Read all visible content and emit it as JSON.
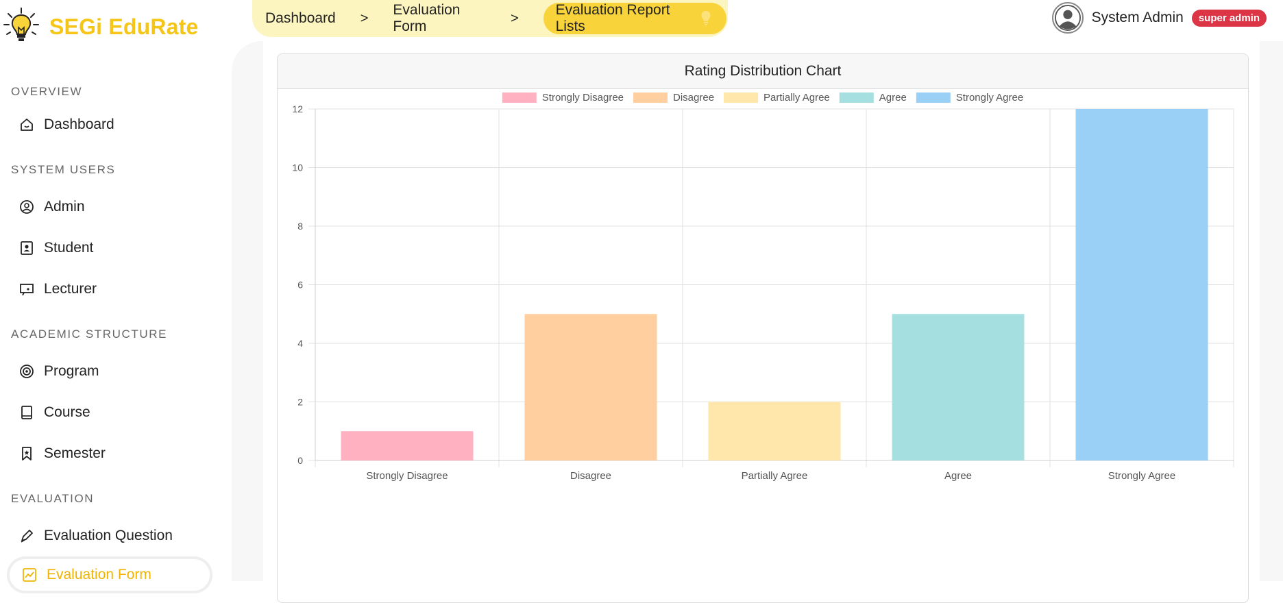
{
  "brand": {
    "name": "SEGi EduRate",
    "logo_icon": "lightbulb-icon",
    "logo_color": "#f5c518"
  },
  "sidebar": {
    "sections": [
      {
        "label": "OVERVIEW"
      },
      {
        "label": "SYSTEM USERS"
      },
      {
        "label": "ACADEMIC STRUCTURE"
      },
      {
        "label": "EVALUATION"
      }
    ],
    "items": [
      {
        "label": "Dashboard",
        "icon": "home-icon"
      },
      {
        "label": "Admin",
        "icon": "user-circle-icon"
      },
      {
        "label": "Student",
        "icon": "student-id-icon"
      },
      {
        "label": "Lecturer",
        "icon": "presentation-icon"
      },
      {
        "label": "Program",
        "icon": "target-icon"
      },
      {
        "label": "Course",
        "icon": "book-icon"
      },
      {
        "label": "Semester",
        "icon": "bookmark-icon"
      },
      {
        "label": "Evaluation Question",
        "icon": "pen-icon"
      },
      {
        "label": "Evaluation Form",
        "icon": "chart-icon",
        "active": true
      }
    ]
  },
  "breadcrumb": {
    "items": [
      "Dashboard",
      "Evaluation Form"
    ],
    "separator": ">",
    "current": "Evaluation Report Lists",
    "current_icon": "lightbulb-icon",
    "bg_color": "#fdf5c0",
    "active_color": "#f9d33a"
  },
  "user": {
    "name": "System Admin",
    "role_badge": "super admin",
    "badge_color": "#dc3545",
    "avatar_icon": "avatar-icon"
  },
  "card": {
    "title": "Rating Distribution Chart"
  },
  "chart_data": {
    "type": "bar",
    "title": "Rating Distribution Chart",
    "categories": [
      "Strongly Disagree",
      "Disagree",
      "Partially Agree",
      "Agree",
      "Strongly Agree"
    ],
    "values": [
      1,
      5,
      2,
      5,
      12
    ],
    "colors": [
      "#ffb1c1",
      "#ffcf9f",
      "#ffe6aa",
      "#a5dfdf",
      "#9ad0f5"
    ],
    "legend": [
      "Strongly Disagree",
      "Disagree",
      "Partially Agree",
      "Agree",
      "Strongly Agree"
    ],
    "legend_position": "top",
    "ylim": [
      0,
      12
    ],
    "yticks": [
      0,
      2,
      4,
      6,
      8,
      10,
      12
    ],
    "grid": true,
    "xlabel": "",
    "ylabel": ""
  }
}
